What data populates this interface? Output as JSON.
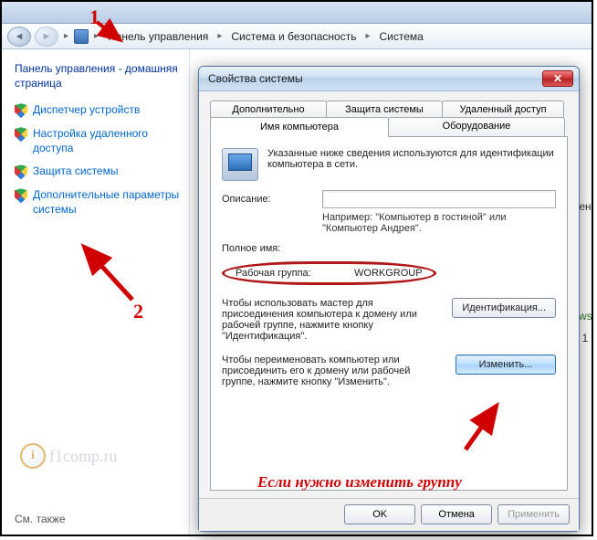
{
  "breadcrumb": {
    "items": [
      "Панель управления",
      "Система и безопасность",
      "Система"
    ]
  },
  "sidebar": {
    "title": "Панель управления - домашняя страница",
    "links": [
      "Диспетчер устройств",
      "Настройка удаленного доступа",
      "Защита системы",
      "Дополнительные параметры системы"
    ],
    "footer": "См. также",
    "watermark": "f1comp.ru"
  },
  "dialog": {
    "title": "Свойства системы",
    "close": "✕",
    "tabs": {
      "dop": "Дополнительно",
      "zas": "Защита системы",
      "uda": "Удаленный доступ",
      "imy": "Имя компьютера",
      "obo": "Оборудование"
    },
    "intro": "Указанные ниже сведения используются для идентификации компьютера в сети.",
    "desc_label": "Описание:",
    "desc_hint": "Например: \"Компьютер в гостиной\" или \"Компьютер Андрея\".",
    "fullname_label": "Полное имя:",
    "workgroup_label": "Рабочая группа:",
    "workgroup_value": "WORKGROUP",
    "ident_text": "Чтобы использовать мастер для присоединения компьютера к домену или рабочей группе, нажмите кнопку \"Идентификация\".",
    "ident_btn": "Идентификация...",
    "change_text": "Чтобы переименовать компьютер или присоединить его к домену или рабочей группе, нажмите кнопку \"Изменить\".",
    "change_btn": "Изменить...",
    "ok": "OK",
    "cancel": "Отмена",
    "apply": "Применить"
  },
  "annotations": {
    "n1": "1",
    "n2": "2",
    "caption": "Если нужно изменить группу"
  },
  "truncated": {
    "a": "ен",
    "b": "ws",
    "c": "1"
  }
}
